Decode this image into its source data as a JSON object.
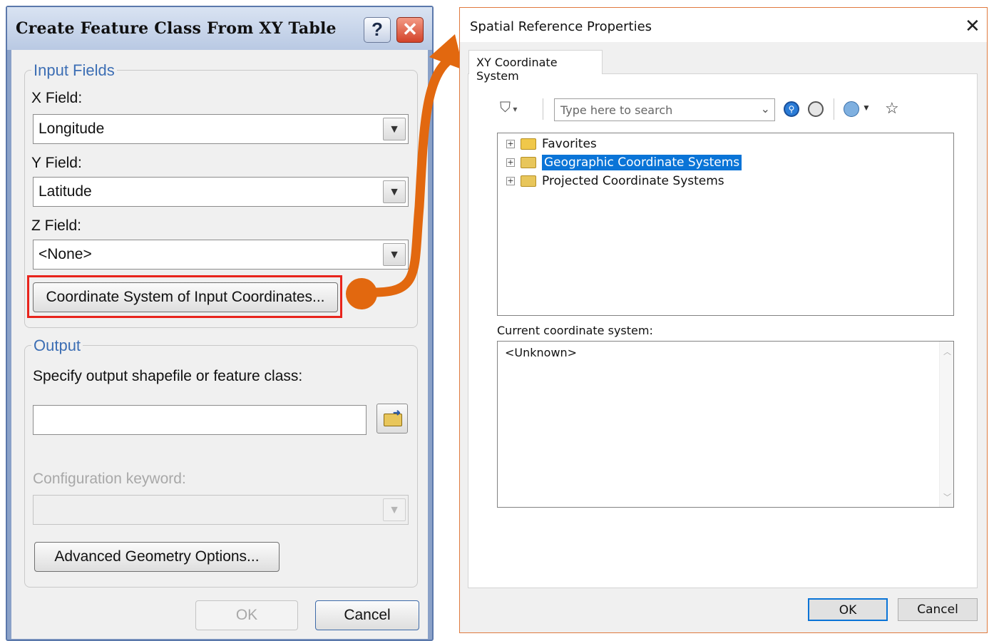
{
  "left_dialog": {
    "title": "Create Feature Class From XY Table",
    "help_glyph": "?",
    "close_glyph": "✕",
    "input_fields": {
      "legend": "Input Fields",
      "x_label": "X Field:",
      "x_value": "Longitude",
      "y_label": "Y Field:",
      "y_value": "Latitude",
      "z_label": "Z Field:",
      "z_value": "<None>",
      "coord_button": "Coordinate System of Input Coordinates..."
    },
    "output": {
      "legend": "Output",
      "specify_label": "Specify output shapefile or feature class:",
      "output_value": "",
      "config_label": "Configuration keyword:",
      "config_value": "",
      "advanced_button": "Advanced Geometry Options..."
    },
    "ok_label": "OK",
    "cancel_label": "Cancel"
  },
  "right_dialog": {
    "title": "Spatial Reference Properties",
    "close_glyph": "✕",
    "tab_label": "XY Coordinate System",
    "search_placeholder": "Type here to search",
    "tree": [
      {
        "label": "Favorites",
        "selected": false
      },
      {
        "label": "Geographic Coordinate Systems",
        "selected": true
      },
      {
        "label": "Projected Coordinate Systems",
        "selected": false
      }
    ],
    "current_label": "Current coordinate system:",
    "current_value": "<Unknown>",
    "ok_label": "OK",
    "cancel_label": "Cancel"
  },
  "colors": {
    "highlight_box": "#e8241c",
    "arrow": "#e2680f",
    "selection": "#0a74d7"
  }
}
